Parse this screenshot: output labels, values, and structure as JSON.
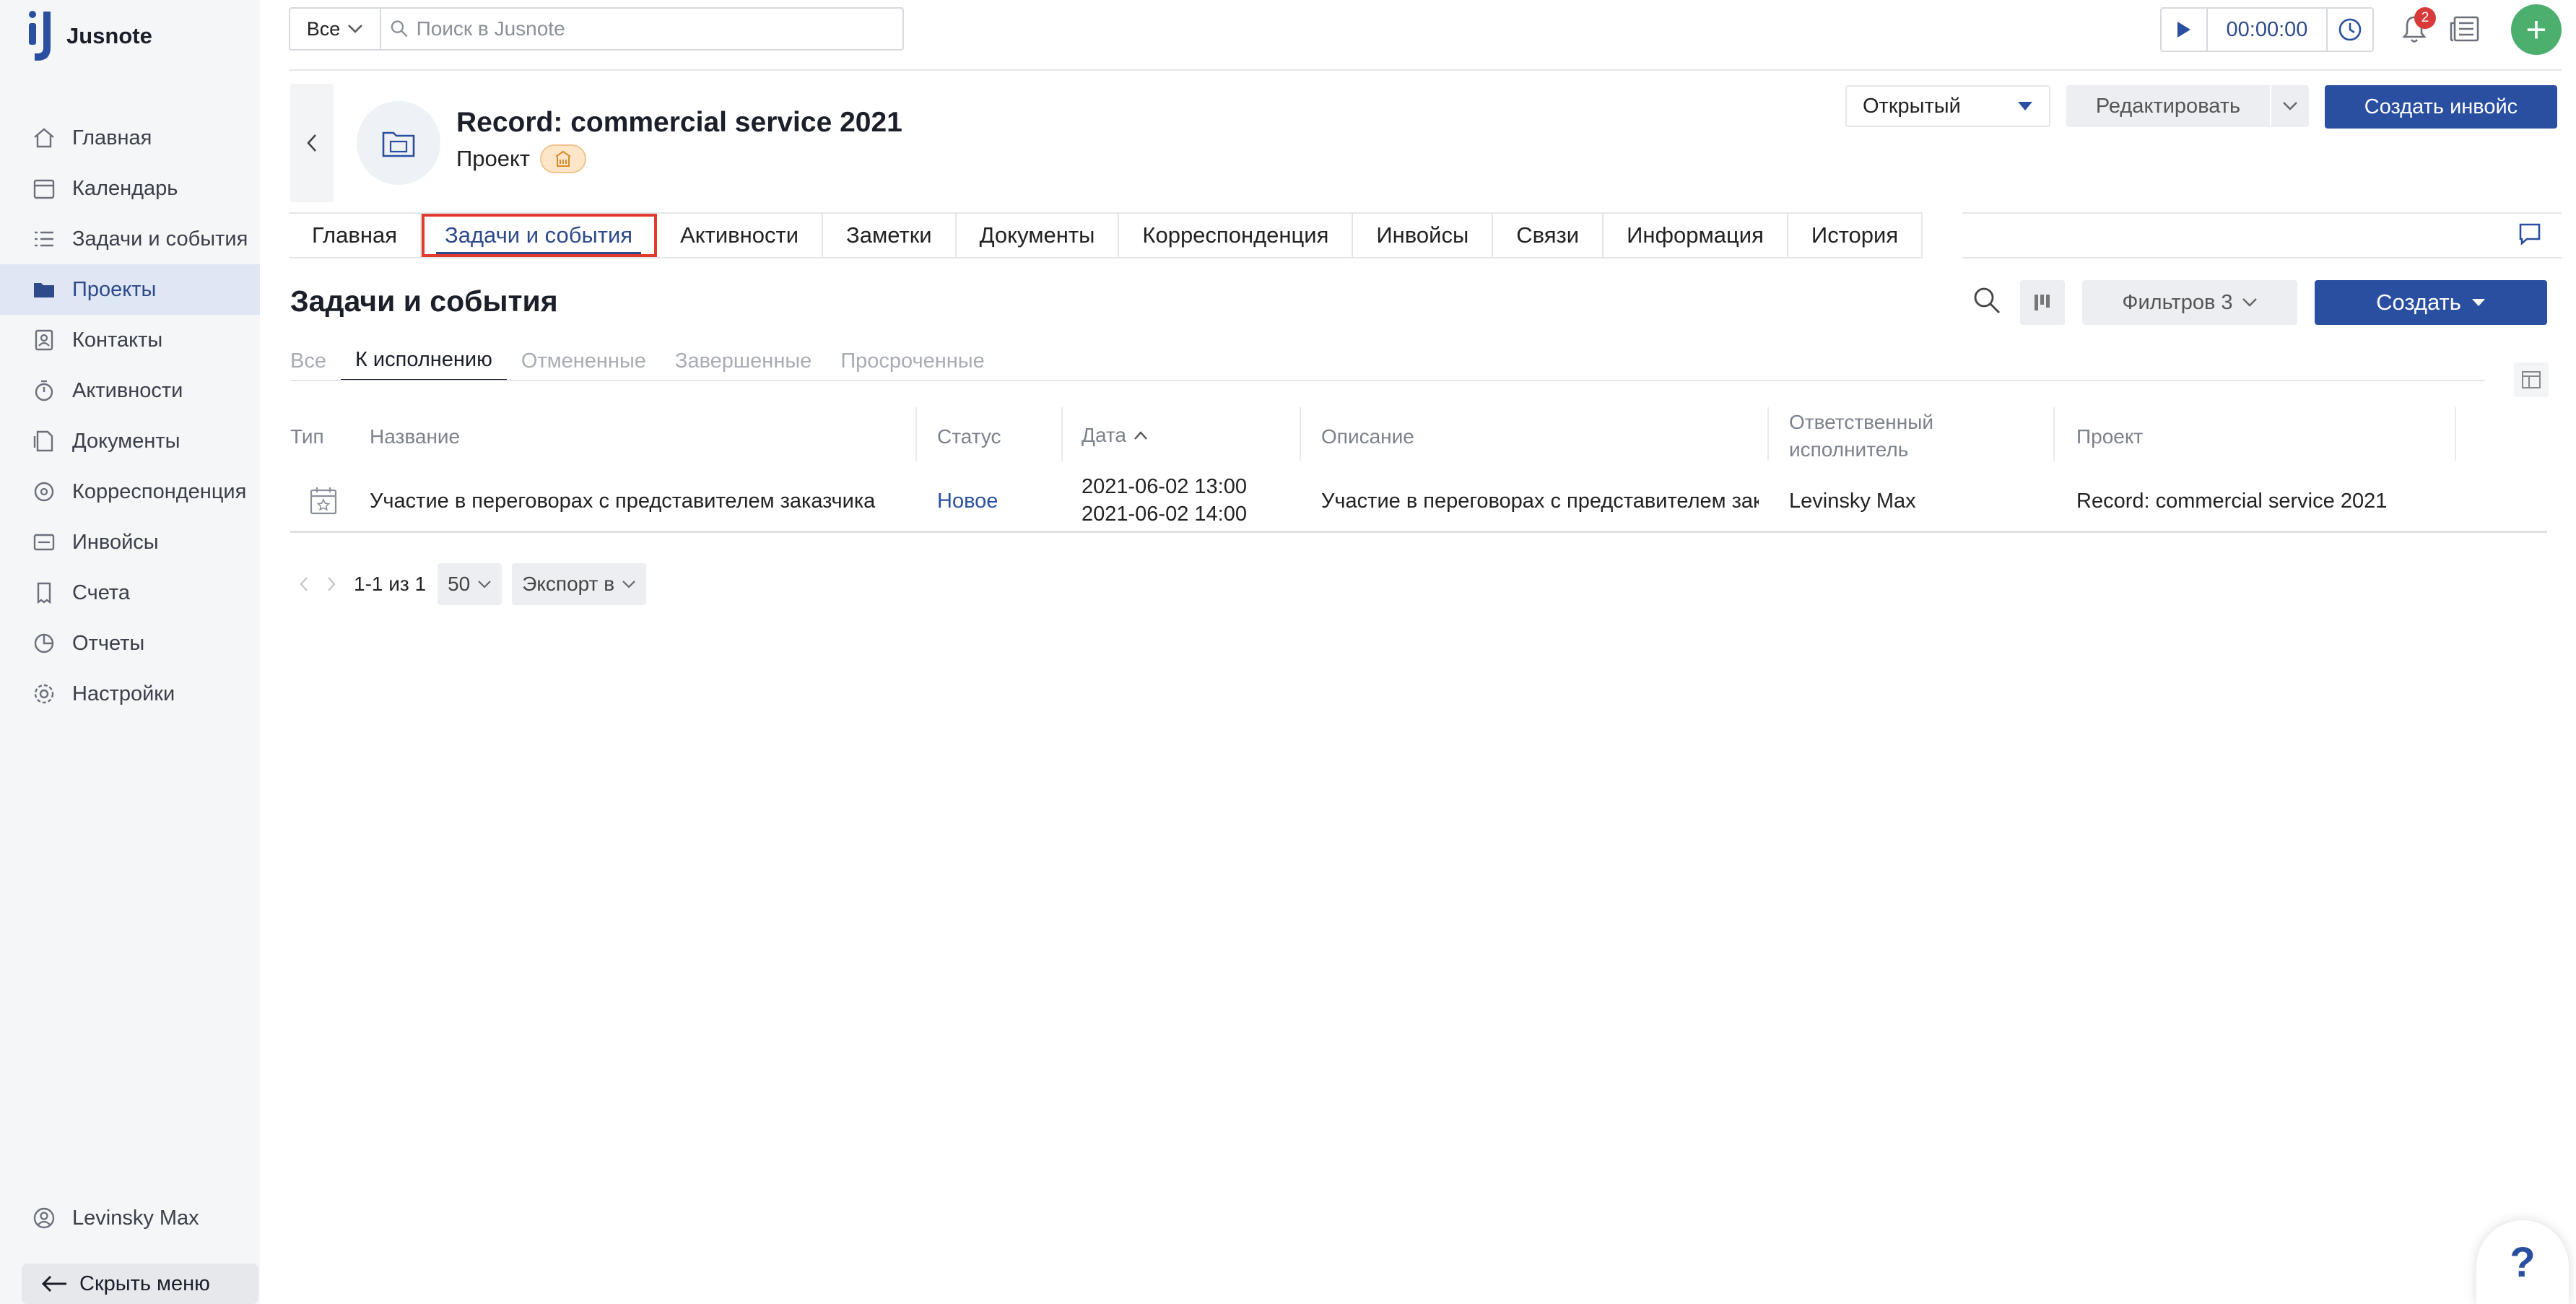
{
  "app": {
    "name": "Jusnote"
  },
  "colors": {
    "accent": "#2a4fa0",
    "active_nav_bg": "#dfe6f4",
    "add_button": "#4caf6e",
    "badge": "#d83a3a",
    "highlight_outline": "#e23b2e"
  },
  "sidebar": {
    "items": [
      {
        "label": "Главная",
        "icon": "home-icon"
      },
      {
        "label": "Календарь",
        "icon": "calendar-icon"
      },
      {
        "label": "Задачи и события",
        "icon": "tasks-icon"
      },
      {
        "label": "Проекты",
        "icon": "folder-icon",
        "active": true
      },
      {
        "label": "Контакты",
        "icon": "contacts-icon"
      },
      {
        "label": "Активности",
        "icon": "activity-icon"
      },
      {
        "label": "Документы",
        "icon": "documents-icon"
      },
      {
        "label": "Корреспонденция",
        "icon": "mail-icon"
      },
      {
        "label": "Инвойсы",
        "icon": "invoice-icon"
      },
      {
        "label": "Счета",
        "icon": "accounts-icon"
      },
      {
        "label": "Отчеты",
        "icon": "reports-icon"
      },
      {
        "label": "Настройки",
        "icon": "gear-icon"
      }
    ],
    "user_name": "Levinsky Max",
    "hide_menu_label": "Скрыть меню"
  },
  "topbar": {
    "search_scope": "Все",
    "search_placeholder": "Поиск в Jusnote",
    "timer": "00:00:00",
    "notifications_count": "2"
  },
  "record": {
    "title": "Record: commercial service 2021",
    "type": "Проект",
    "status": "Открытый",
    "edit_label": "Редактировать",
    "create_invoice_label": "Создать инвойс"
  },
  "tabs": [
    {
      "label": "Главная"
    },
    {
      "label": "Задачи и события",
      "active": true
    },
    {
      "label": "Активности"
    },
    {
      "label": "Заметки"
    },
    {
      "label": "Документы"
    },
    {
      "label": "Корреспонденция"
    },
    {
      "label": "Инвойсы"
    },
    {
      "label": "Связи"
    },
    {
      "label": "Информация"
    },
    {
      "label": "История"
    }
  ],
  "section": {
    "title": "Задачи и события",
    "filters_label": "Фильтров 3",
    "create_label": "Создать",
    "subtabs": [
      {
        "label": "Все"
      },
      {
        "label": "К исполнению",
        "active": true
      },
      {
        "label": "Отмененные"
      },
      {
        "label": "Завершенные"
      },
      {
        "label": "Просроченные"
      }
    ]
  },
  "table": {
    "columns": {
      "type": "Тип",
      "name": "Название",
      "status": "Статус",
      "date": "Дата",
      "description": "Описание",
      "assignee_line1": "Ответственный",
      "assignee_line2": "исполнитель",
      "project": "Проект"
    },
    "rows": [
      {
        "type_icon": "event-calendar-icon",
        "name": "Участие в переговорах с представителем заказчика",
        "status": "Новое",
        "date_start": "2021-06-02 13:00",
        "date_end": "2021-06-02 14:00",
        "description": "Участие в переговорах с представителем заказчика",
        "assignee": "Levinsky Max",
        "project": "Record: commercial service 2021"
      }
    ]
  },
  "pagination": {
    "range": "1-1 из 1",
    "page_size": "50",
    "export_label": "Экспорт в"
  },
  "help": {
    "label": "?"
  }
}
